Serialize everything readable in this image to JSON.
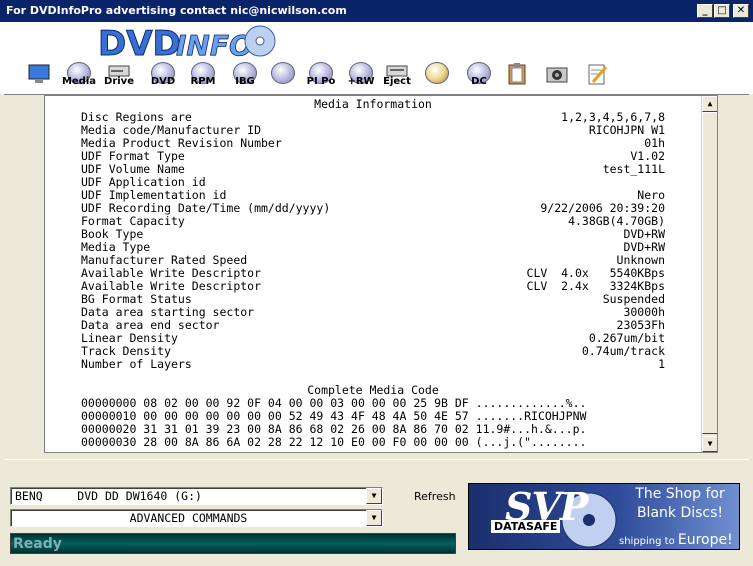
{
  "window": {
    "title": "For DVDInfoPro advertising contact nic@nicwilson.com",
    "minimize": "_",
    "maximize": "□",
    "close": "✕"
  },
  "toolbar": {
    "items": [
      {
        "label": "",
        "icon": "monitor-icon"
      },
      {
        "label": "Media",
        "icon": "disc-icon"
      },
      {
        "label": "Drive",
        "icon": "drive-icon"
      },
      {
        "label": "DVD",
        "icon": "dvd-icon"
      },
      {
        "label": "RPM",
        "icon": "rpm-icon"
      },
      {
        "label": "IBG",
        "icon": "ibg-icon"
      },
      {
        "label": "",
        "icon": "magnifier-icon"
      },
      {
        "label": "PI Po",
        "icon": "pipo-icon"
      },
      {
        "label": "+RW",
        "icon": "rw-icon"
      },
      {
        "label": "Eject",
        "icon": "eject-icon"
      },
      {
        "label": "",
        "icon": "tools-icon"
      },
      {
        "label": "DC",
        "icon": "dc-icon"
      },
      {
        "label": "",
        "icon": "clipboard-icon"
      },
      {
        "label": "",
        "icon": "camera-icon"
      },
      {
        "label": "",
        "icon": "notepad-icon"
      }
    ]
  },
  "report": {
    "heading": "Media Information",
    "rows": [
      {
        "key": "Disc Regions are",
        "value": "1,2,3,4,5,6,7,8"
      },
      {
        "key": "Media code/Manufacturer ID",
        "value": "RICOHJPN W1"
      },
      {
        "key": "Media Product Revision Number",
        "value": "01h"
      },
      {
        "key": "UDF Format Type",
        "value": "V1.02"
      },
      {
        "key": "UDF Volume Name",
        "value": "test_111L"
      },
      {
        "key": "UDF Application id",
        "value": ""
      },
      {
        "key": "UDF Implementation id",
        "value": "Nero"
      },
      {
        "key": "UDF Recording Date/Time (mm/dd/yyyy)",
        "value": "9/22/2006 20:39:20"
      },
      {
        "key": "Format Capacity",
        "value": "4.38GB(4.70GB)"
      },
      {
        "key": "Book Type",
        "value": "DVD+RW"
      },
      {
        "key": "Media Type",
        "value": "DVD+RW"
      },
      {
        "key": "Manufacturer Rated Speed",
        "value": "Unknown"
      },
      {
        "key": "Available Write Descriptor",
        "value": "CLV  4.0x   5540KBps"
      },
      {
        "key": "Available Write Descriptor",
        "value": "CLV  2.4x   3324KBps"
      },
      {
        "key": "BG Format Status",
        "value": "Suspended"
      },
      {
        "key": "Data area starting sector",
        "value": "30000h"
      },
      {
        "key": "Data area end sector",
        "value": "23053Fh"
      },
      {
        "key": "Linear Density",
        "value": "0.267um/bit"
      },
      {
        "key": "Track Density",
        "value": "0.74um/track"
      },
      {
        "key": "Number of Layers",
        "value": "1"
      }
    ],
    "code_heading": "Complete Media Code",
    "hex_lines": [
      "00000000 08 02 00 00 92 0F 04 00 00 03 00 00 00 25 9B DF .............%..",
      "00000010 00 00 00 00 00 00 00 52 49 43 4F 48 4A 50 4E 57 .......RICOHJPNW",
      "00000020 31 31 01 39 23 00 8A 86 68 02 26 00 8A 86 70 02 11.9#...h.&...p.",
      "00000030 28 00 8A 86 6A 02 28 22 12 10 E0 00 F0 00 00 00 (...j.(\"........"
    ]
  },
  "bottom": {
    "drive_select": "BENQ     DVD DD DW1640 (G:)",
    "command_select": "ADVANCED COMMANDS",
    "refresh_label": "Refresh",
    "status_text": "Ready"
  },
  "ad": {
    "brand": "SVP",
    "sub": "DATASAFE",
    "tagline": "The Shop for Blank Discs!",
    "shipping_prefix": "shipping to",
    "shipping_dest": "Europe!"
  }
}
